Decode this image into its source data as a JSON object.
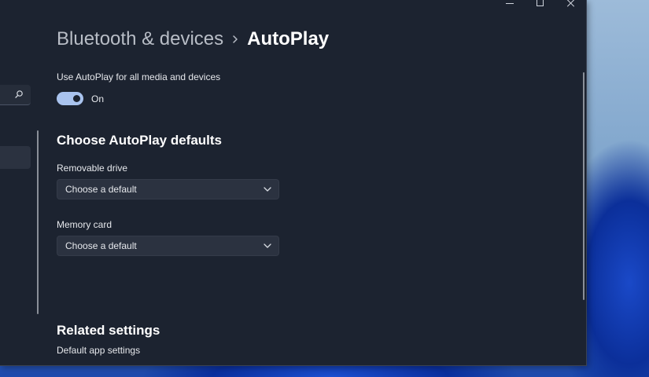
{
  "window": {
    "caption_buttons": [
      "minimize",
      "maximize",
      "close"
    ]
  },
  "header": {
    "breadcrumb_parent": "Bluetooth & devices",
    "breadcrumb_separator_icon": "chevron-right-icon",
    "page_title": "AutoPlay"
  },
  "autoplay_toggle": {
    "label": "Use AutoPlay for all media and devices",
    "state_text": "On",
    "is_on": true,
    "accent_color": "#a9c3ee"
  },
  "defaults_section": {
    "heading": "Choose AutoPlay defaults",
    "removable_drive": {
      "label": "Removable drive",
      "value": "Choose a default"
    },
    "memory_card": {
      "label": "Memory card",
      "value": "Choose a default"
    }
  },
  "related_section": {
    "heading": "Related settings",
    "link": "Default app settings"
  }
}
